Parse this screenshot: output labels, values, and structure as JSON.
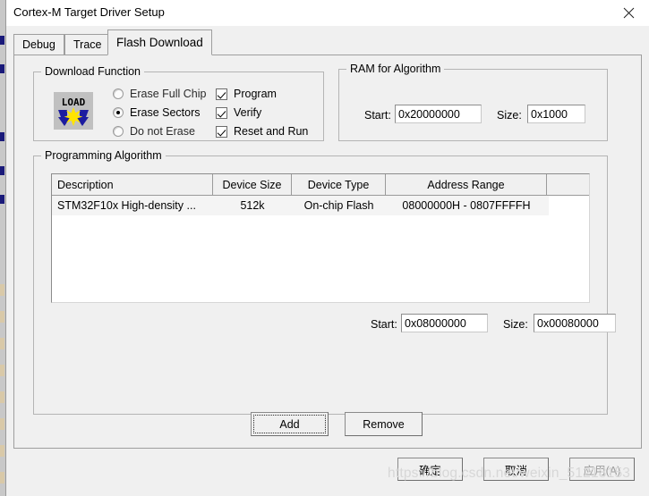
{
  "window": {
    "title": "Cortex-M Target Driver Setup",
    "close_icon": "close-icon"
  },
  "tabs": [
    {
      "label": "Debug",
      "active": false
    },
    {
      "label": "Trace",
      "active": false
    },
    {
      "label": "Flash Download",
      "active": true
    }
  ],
  "download_function": {
    "legend": "Download Function",
    "icon": "load-icon",
    "icon_text": "LOAD",
    "erase_options": [
      {
        "label": "Erase Full Chip",
        "selected": false
      },
      {
        "label": "Erase Sectors",
        "selected": true
      },
      {
        "label": "Do not Erase",
        "selected": false
      }
    ],
    "checkboxes": [
      {
        "label": "Program",
        "checked": true
      },
      {
        "label": "Verify",
        "checked": true
      },
      {
        "label": "Reset and Run",
        "checked": true
      }
    ]
  },
  "ram_for_algorithm": {
    "legend": "RAM for Algorithm",
    "start_label": "Start:",
    "start_value": "0x20000000",
    "size_label": "Size:",
    "size_value": "0x1000"
  },
  "programming_algorithm": {
    "legend": "Programming Algorithm",
    "columns": [
      "Description",
      "Device Size",
      "Device Type",
      "Address Range",
      ""
    ],
    "rows": [
      {
        "description": "STM32F10x High-density ...",
        "device_size": "512k",
        "device_type": "On-chip Flash",
        "address_range": "08000000H - 0807FFFFH",
        "selected": true
      }
    ],
    "start_label": "Start:",
    "start_value": "0x08000000",
    "size_label": "Size:",
    "size_value": "0x00080000",
    "add_label": "Add",
    "remove_label": "Remove"
  },
  "dialog_buttons": {
    "ok_label": "确定",
    "cancel_label": "取消",
    "apply_label": "应用(A)",
    "apply_disabled": true
  },
  "watermark": {
    "text": "https://blog.csdn.net/weixin_51218153"
  },
  "colors": {
    "dialog_bg": "#f0f0f0",
    "titlebar_bg": "#ffffff",
    "field_bg": "#ffffff",
    "row_selected_bg": "#f4f4f4",
    "icon_blue": "#1c1ca0",
    "icon_yellow": "#ffe400",
    "border": "#9e9e9e"
  }
}
